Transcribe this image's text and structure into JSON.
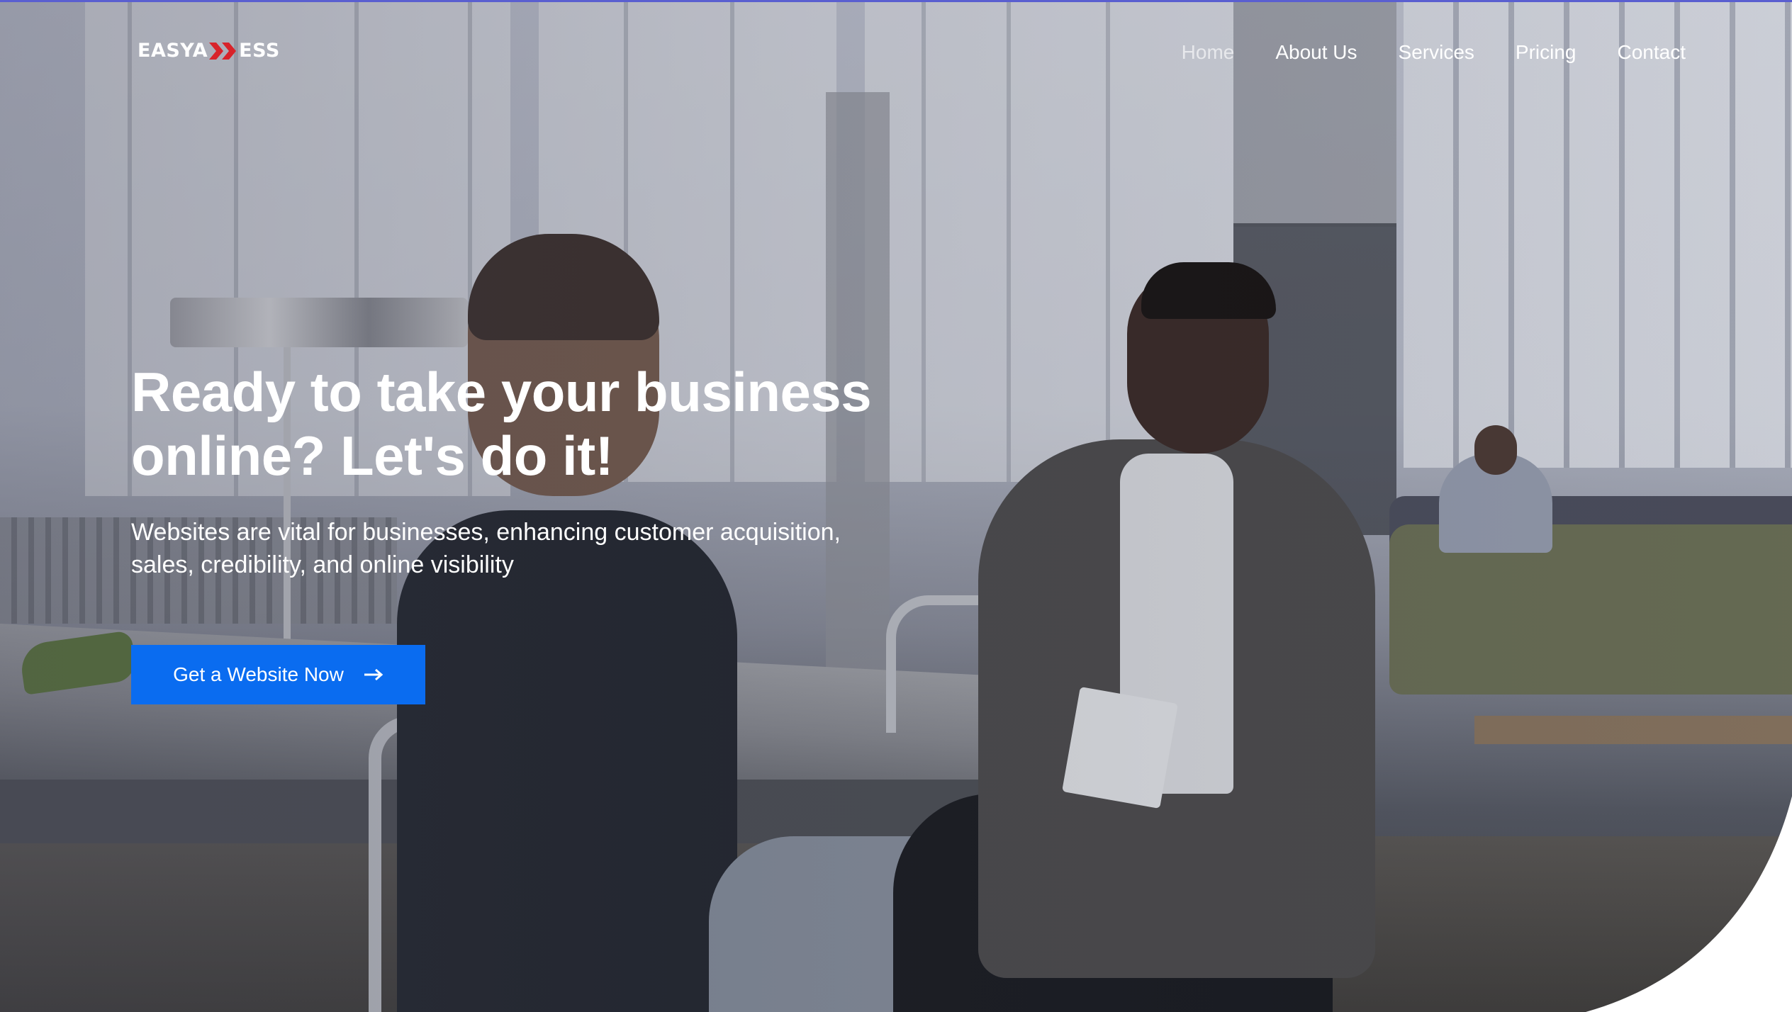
{
  "brand": {
    "logo_left": "EASYA",
    "logo_right": "ESS",
    "accent_color": "#d8232a"
  },
  "nav": {
    "items": [
      {
        "label": "Home",
        "active": true
      },
      {
        "label": "About Us",
        "active": false
      },
      {
        "label": "Services",
        "active": false
      },
      {
        "label": "Pricing",
        "active": false
      },
      {
        "label": "Contact",
        "active": false
      }
    ]
  },
  "hero": {
    "title_line1": "Ready to take your business",
    "title_line2": "online? Let's do it!",
    "subtitle_line1": "Websites are vital for businesses, enhancing customer acquisition,",
    "subtitle_line2": "sales, credibility, and online visibility",
    "cta_label": "Get a Website Now",
    "cta_icon": "arrow-right-icon",
    "cta_color": "#0a6cf0"
  }
}
